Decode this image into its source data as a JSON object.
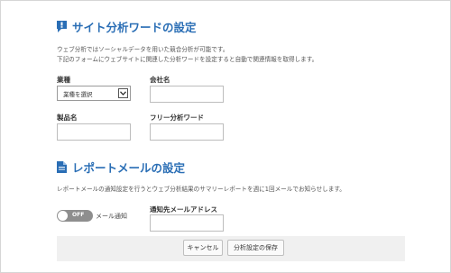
{
  "section1": {
    "title": "サイト分析ワードの設定",
    "desc_line1": "ウェブ分析ではソーシャルデータを用いた競合分析が可能です。",
    "desc_line2": "下記のフォームにウェブサイトに関連した分析ワードを設定すると自動で関連情報を取得します。"
  },
  "form": {
    "industry_label": "業種",
    "industry_selected": "業種を選択",
    "company_label": "会社名",
    "company_value": "",
    "product_label": "製品名",
    "product_value": "",
    "free_word_label": "フリー分析ワード",
    "free_word_value": ""
  },
  "section2": {
    "title": "レポートメールの設定",
    "desc": "レポートメールの通知設定を行うとウェブ分析結果のサマリーレポートを週に1回メールでお知らせします。"
  },
  "mail": {
    "toggle_state": "OFF",
    "toggle_label": "メール通知",
    "address_label": "通知先メールアドレス",
    "address_value": ""
  },
  "buttons": {
    "cancel": "キャンセル",
    "save": "分析設定の保存"
  },
  "colors": {
    "accent": "#2a6eb5",
    "toggle_off": "#8e8e8e",
    "footer_bg": "#f0f0f0"
  }
}
